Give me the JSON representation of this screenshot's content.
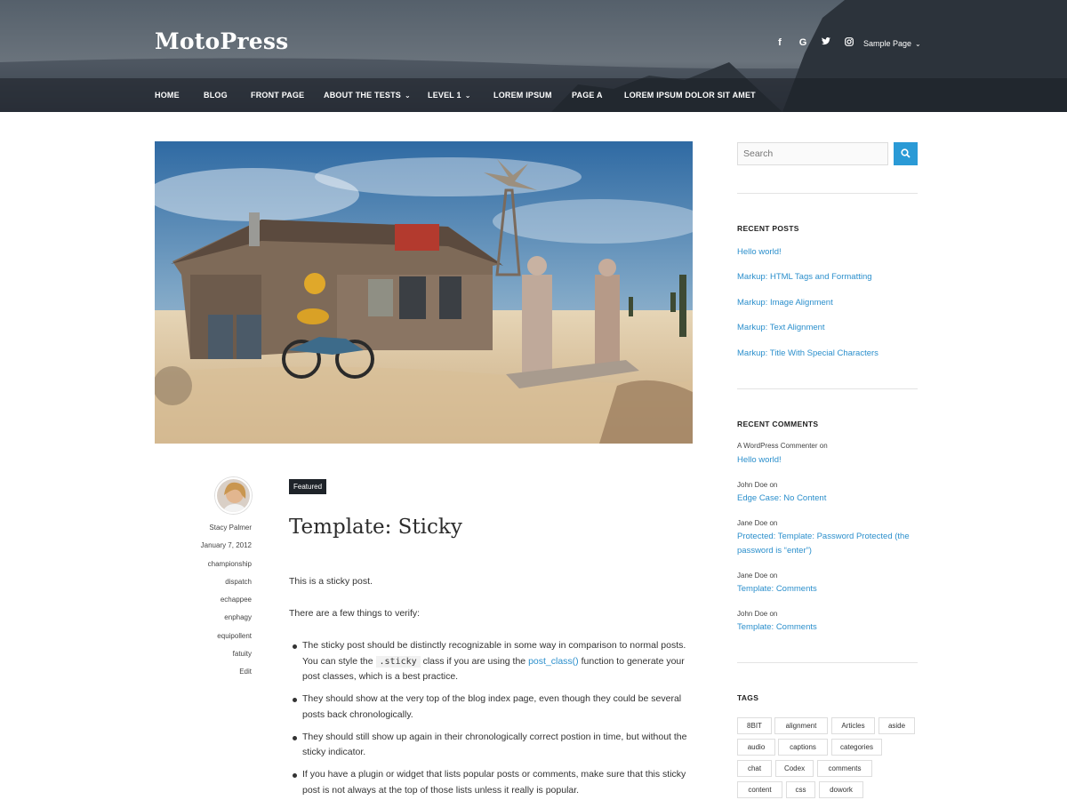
{
  "header": {
    "site_title": "MotoPress",
    "social_icons": [
      "facebook-icon",
      "google-icon",
      "twitter-icon",
      "instagram-icon"
    ],
    "social_glyphs": [
      "f",
      "G",
      "t",
      "◎"
    ],
    "sample_page": "Sample Page"
  },
  "nav": {
    "items": [
      {
        "label": "HOME"
      },
      {
        "label": "BLOG"
      },
      {
        "label": "FRONT PAGE"
      },
      {
        "label": "ABOUT THE TESTS"
      },
      {
        "label": "LEVEL 1"
      },
      {
        "label": "LOREM IPSUM"
      },
      {
        "label": "PAGE A"
      },
      {
        "label": "LOREM IPSUM DOLOR SIT AMET"
      }
    ]
  },
  "post": {
    "badge": "Featured",
    "title": "Template: Sticky",
    "author": "Stacy Palmer",
    "date": "January 7, 2012",
    "tags": [
      "championship",
      "dispatch",
      "echappee",
      "enphagy",
      "equipollent",
      "fatuity"
    ],
    "edit": "Edit",
    "p1": "This is a sticky post.",
    "p2": "There are a few things to verify:",
    "bullet1_a": "The sticky post should be distinctly recognizable in some way in comparison to normal posts. You can style the ",
    "bullet1_code": ".sticky",
    "bullet1_b": " class if you are using the ",
    "bullet1_link": "post_class()",
    "bullet1_c": " function to generate your post classes, which is a best practice.",
    "bullet2": "They should show at the very top of the blog index page, even though they could be several posts back chronologically.",
    "bullet3": "They should still show up again in their chronologically correct postion in time, but without the sticky indicator.",
    "bullet4": "If you have a plugin or widget that lists popular posts or comments, make sure that this sticky post is not always at the top of those lists unless it really is popular."
  },
  "sidebar": {
    "search_placeholder": "Search",
    "recent_posts_title": "RECENT POSTS",
    "recent_posts": [
      "Hello world!",
      "Markup: HTML Tags and Formatting",
      "Markup: Image Alignment",
      "Markup: Text Alignment",
      "Markup: Title With Special Characters"
    ],
    "recent_comments_title": "RECENT COMMENTS",
    "recent_comments": [
      {
        "author": "A WordPress Commenter on",
        "post": "Hello world!"
      },
      {
        "author": "John Doe on",
        "post": "Edge Case: No Content"
      },
      {
        "author": "Jane Doe on",
        "post": "Protected: Template: Password Protected (the password is “enter”)"
      },
      {
        "author": "Jane Doe on",
        "post": "Template: Comments"
      },
      {
        "author": "John Doe on",
        "post": "Template: Comments"
      }
    ],
    "tags_title": "TAGS",
    "tags": [
      "8BIT",
      "alignment",
      "Articles",
      "aside",
      "audio",
      "captions",
      "categories",
      "chat",
      "Codex",
      "comments",
      "content",
      "css",
      "dowork"
    ]
  }
}
